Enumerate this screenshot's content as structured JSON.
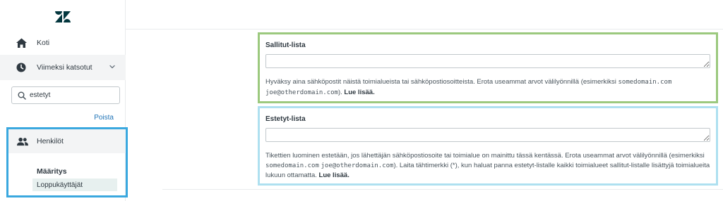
{
  "sidebar": {
    "logo_icon": "zendesk-logo",
    "home": {
      "icon": "home-icon",
      "label": "Koti"
    },
    "recent": {
      "icon": "clock-icon",
      "label": "Viimeksi katsotut",
      "expand_icon": "chevron-down-icon"
    },
    "search": {
      "icon": "search-icon",
      "value": "estetyt",
      "placeholder": ""
    },
    "clear_label": "Poista",
    "people": {
      "icon": "people-icon",
      "label": "Henkilöt",
      "section_heading": "Määritys",
      "selected_item": "Loppukäyttäjät"
    }
  },
  "allowlist": {
    "title": "Sallitut-lista",
    "value": "",
    "hint_pre": "Hyväksy aina sähköpostit näistä toimialueista tai sähköpostiosoitteista. Erota useammat arvot välilyönnillä (esimerkiksi ",
    "hint_code1": "somedomain.com",
    "hint_code2": "joe@otherdomain.com",
    "hint_post": "). ",
    "learn_more": "Lue lisää."
  },
  "blocklist": {
    "title": "Estetyt-lista",
    "value": "",
    "hint_pre": "Tikettien luominen estetään, jos lähettäjän sähköpostiosoite tai toimialue on mainittu tässä kentässä. Erota useammat arvot välilyönnillä (esimerkiksi ",
    "hint_code1": "somedomain.com",
    "hint_code2": "joe@otherdomain.com",
    "hint_post": "). Laita tähtimerkki (*), kun haluat panna estetyt-listalle kaikki toimialueet sallitut-listalle lisättyjä toimialueita lukuun ottamatta. ",
    "learn_more": "Lue lisää."
  },
  "colors": {
    "allowlist_highlight": "#9cc97e",
    "blocklist_highlight": "#aee0f0",
    "people_highlight": "#3aa8df",
    "link": "#1f73b7",
    "selected_item_bg": "#e7f0ef"
  }
}
